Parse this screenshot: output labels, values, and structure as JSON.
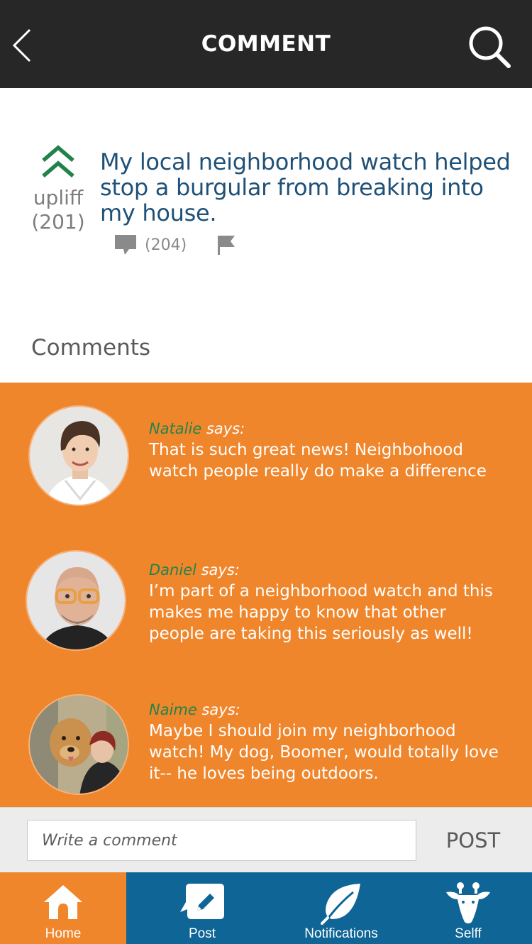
{
  "header": {
    "title": "COMMENT",
    "back_icon": "chevron-left-icon",
    "search_icon": "search-icon"
  },
  "post": {
    "vote_label": "upliff",
    "vote_count": "(201)",
    "text": "My local neighborhood watch helped stop a burgular from breaking into my house.",
    "comment_count": "(204)"
  },
  "comments_heading": "Comments",
  "comments": [
    {
      "author": "Natalie",
      "says": " says:",
      "text": "That is such great news! Neighbohood watch people really do make a difference"
    },
    {
      "author": "Daniel",
      "says": " says:",
      "text": "I’m part of a neighborhood watch and this makes me happy to know that other people are taking this seriously as well!"
    },
    {
      "author": "Naime",
      "says": " says:",
      "text": "Maybe I should join my neighborhood watch! My dog, Boomer, would totally love it-- he loves being outdoors."
    }
  ],
  "composer": {
    "placeholder": "Write a comment",
    "post_label": "POST"
  },
  "tabs": [
    {
      "label": "Home",
      "icon": "home-icon"
    },
    {
      "label": "Post",
      "icon": "pencil-icon"
    },
    {
      "label": "Notifications",
      "icon": "leaf-icon"
    },
    {
      "label": "Selff",
      "icon": "giraffe-icon"
    }
  ],
  "colors": {
    "header_bg": "#272727",
    "accent_orange": "#f0862c",
    "tab_blue": "#0e6596",
    "upvote_green": "#22834a",
    "post_text_blue": "#1f5178"
  }
}
